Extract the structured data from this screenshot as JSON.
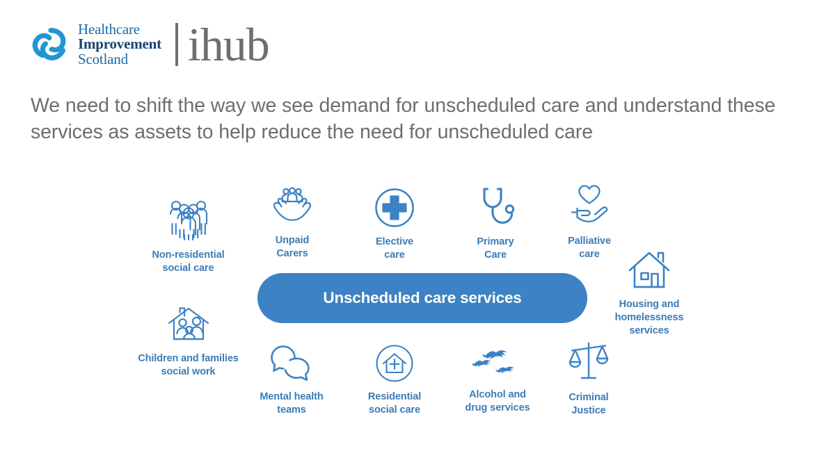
{
  "logo": {
    "mark_name": "healthcare-improvement-scotland-knot",
    "line1": "Healthcare",
    "line2": "Improvement",
    "line3": "Scotland",
    "wordmark": "ihub",
    "brand_blue": "#1c6aa8",
    "brand_navy": "#15446e",
    "wordmark_gray": "#6d6e70"
  },
  "headline": {
    "text": "We need to shift the way we see demand for unscheduled care and understand these services as assets to help reduce the need for unscheduled care",
    "color": "#6d6e70"
  },
  "diagram": {
    "center": {
      "label": "Unscheduled care services",
      "fill": "#3c82c4",
      "text_color": "#ffffff"
    },
    "label_color": "#3b7cb5",
    "icon_color": "#3c82c4",
    "nodes": [
      {
        "id": "non-residential-social-care",
        "icon": "group-of-people-icon",
        "label": "Non-residential\nsocial care"
      },
      {
        "id": "unpaid-carers",
        "icon": "hands-holding-people-icon",
        "label": "Unpaid\nCarers"
      },
      {
        "id": "elective-care",
        "icon": "medical-cross-circle-icon",
        "label": "Elective\ncare"
      },
      {
        "id": "primary-care",
        "icon": "stethoscope-icon",
        "label": "Primary\nCare"
      },
      {
        "id": "palliative-care",
        "icon": "hand-holding-heart-icon",
        "label": "Palliative\ncare"
      },
      {
        "id": "housing-and-homelessness-services",
        "icon": "house-icon",
        "label": "Housing and\nhomelessness\nservices"
      },
      {
        "id": "children-and-families-social-work",
        "icon": "family-under-roof-icon",
        "label": "Children and families\nsocial work"
      },
      {
        "id": "mental-health-teams",
        "icon": "speech-bubbles-icon",
        "label": "Mental health\nteams"
      },
      {
        "id": "residential-social-care",
        "icon": "house-plus-circle-icon",
        "label": "Residential\nsocial care"
      },
      {
        "id": "alcohol-and-drug-services",
        "icon": "flying-birds-icon",
        "label": "Alcohol and\ndrug services"
      },
      {
        "id": "criminal-justice",
        "icon": "scales-of-justice-icon",
        "label": "Criminal\nJustice"
      }
    ]
  }
}
